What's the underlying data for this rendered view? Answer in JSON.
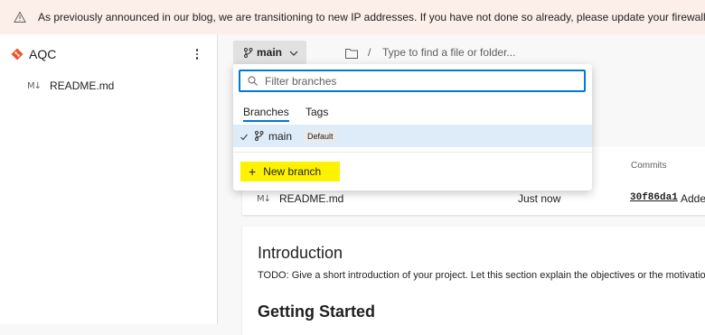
{
  "banner": {
    "icon": "warning-icon",
    "text": "As previously announced in our blog, we are transitioning to new IP addresses. If you have not done so already, please update your firewall allowlist"
  },
  "sidebar": {
    "repo_icon": "repo-diamond-icon",
    "repo_name": "AQC",
    "more_icon": "more-vertical-icon",
    "files": [
      {
        "icon": "markdown-icon",
        "icon_text": "M↓",
        "name": "README.md"
      }
    ]
  },
  "toolbar": {
    "branch_icon": "branch-icon",
    "branch_label": "main",
    "folder_icon": "folder-icon",
    "path_separator": "/",
    "path_placeholder": "Type to find a file or folder..."
  },
  "branch_dropdown": {
    "filter_placeholder": "Filter branches",
    "tabs": [
      "Branches",
      "Tags"
    ],
    "active_tab": "Branches",
    "branches": [
      {
        "name": "main",
        "badge": "Default",
        "selected": true
      }
    ],
    "new_branch_label": "New branch",
    "highlight_color": "#fff200"
  },
  "files_table": {
    "commits_header": "Commits",
    "rows": [
      {
        "icon_text": "M↓",
        "name": "README.md",
        "time": "Just now",
        "commit": "30f86da1",
        "message": "Added"
      }
    ]
  },
  "readme": {
    "heading1": "Introduction",
    "paragraph1": "TODO: Give a short introduction of your project. Let this section explain the objectives or the motivation behind this project.",
    "heading2": "Getting Started"
  },
  "colors": {
    "accent": "#0078d4",
    "banner_bg": "#fcefe9",
    "selected_row_bg": "#deecf9",
    "repo_icon": "#e8562a"
  }
}
